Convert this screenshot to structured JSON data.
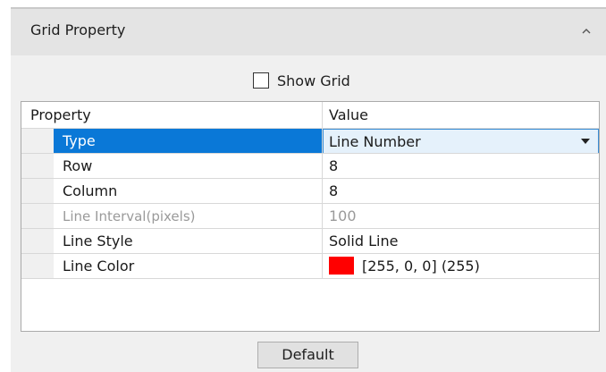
{
  "panel": {
    "title": "Grid Property",
    "collapse_icon": "chevron-up-icon"
  },
  "show_grid": {
    "label": "Show Grid",
    "checked": false
  },
  "grid": {
    "headers": {
      "property": "Property",
      "value": "Value"
    },
    "rows": [
      {
        "name": "Type",
        "value": "Line Number",
        "selected": true,
        "editor": "dropdown"
      },
      {
        "name": "Row",
        "value": "8"
      },
      {
        "name": "Column",
        "value": "8"
      },
      {
        "name": "Line Interval(pixels)",
        "value": "100",
        "disabled": true
      },
      {
        "name": "Line Style",
        "value": "Solid Line"
      },
      {
        "name": "Line Color",
        "value": "[255, 0, 0] (255)",
        "swatch_color": "#ff0000"
      }
    ]
  },
  "buttons": {
    "default_label": "Default"
  },
  "colors": {
    "selection": "#0a78d7",
    "panel_bg": "#f0f0f0",
    "header_bg": "#e4e4e4"
  }
}
